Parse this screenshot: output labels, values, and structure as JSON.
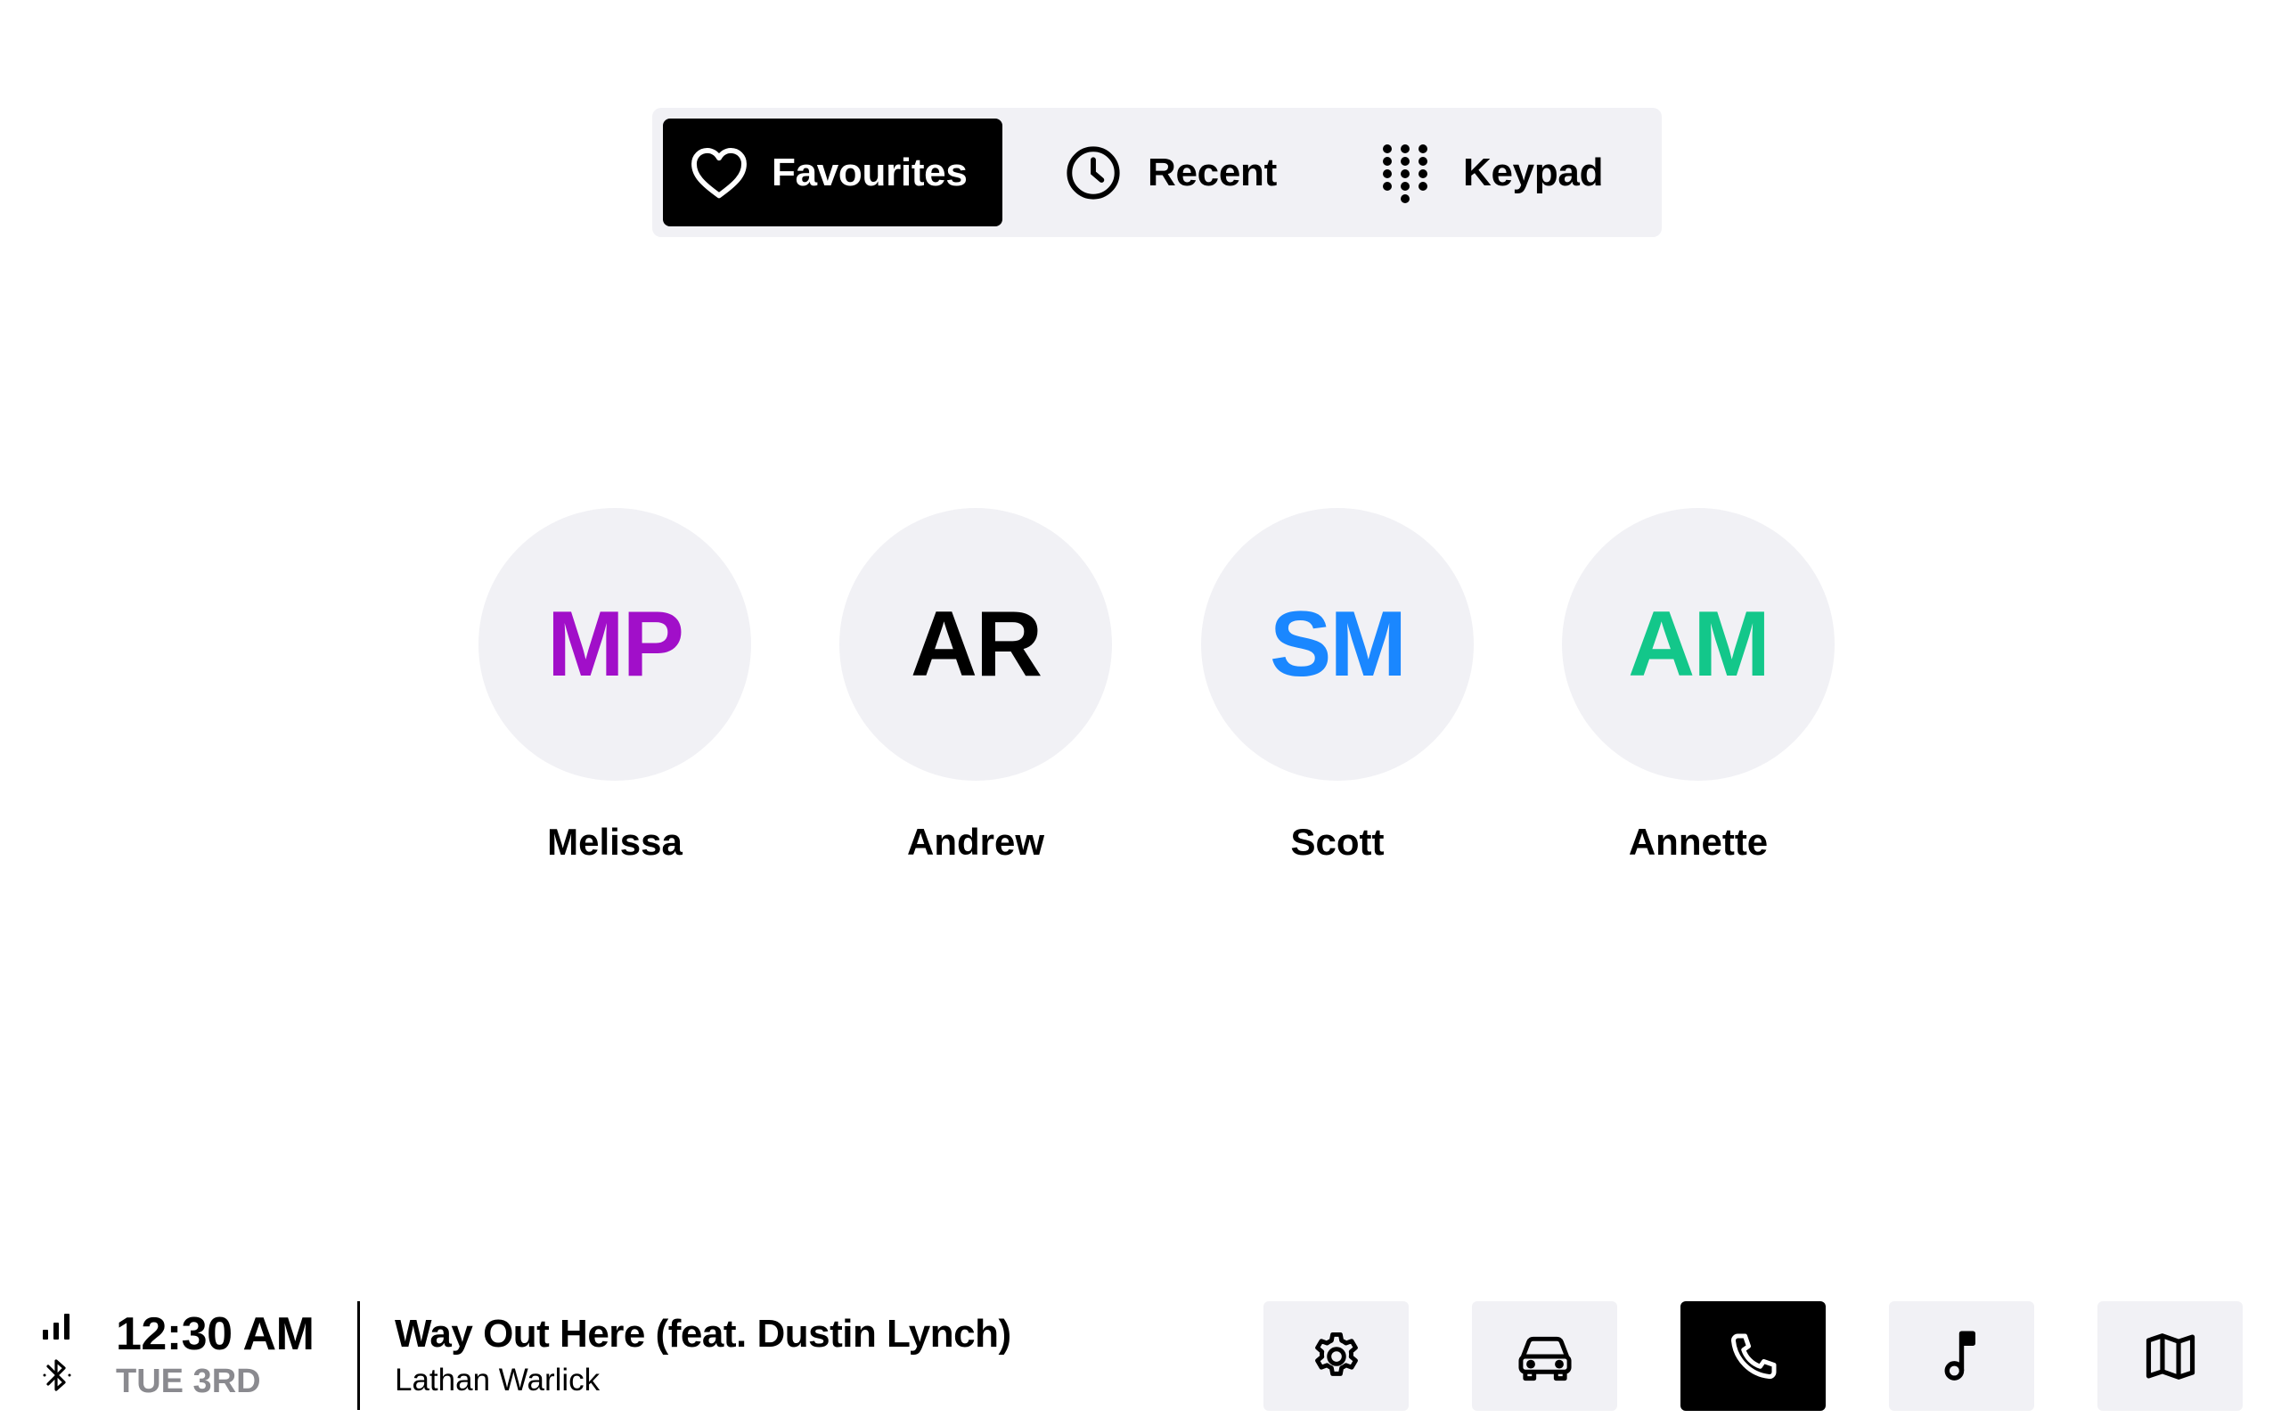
{
  "tabs": [
    {
      "label": "Favourites",
      "icon": "heart-icon",
      "active": true
    },
    {
      "label": "Recent",
      "icon": "clock-icon",
      "active": false
    },
    {
      "label": "Keypad",
      "icon": "keypad-icon",
      "active": false
    }
  ],
  "contacts": [
    {
      "initials": "MP",
      "name": "Melissa",
      "color": "#a10fc9"
    },
    {
      "initials": "AR",
      "name": "Andrew",
      "color": "#000000"
    },
    {
      "initials": "SM",
      "name": "Scott",
      "color": "#1a87ff"
    },
    {
      "initials": "AM",
      "name": "Annette",
      "color": "#13c78a"
    }
  ],
  "status": {
    "time": "12:30 AM",
    "date": "TUE 3RD",
    "icons": [
      "signal-icon",
      "bluetooth-icon"
    ]
  },
  "now_playing": {
    "title": "Way Out Here (feat. Dustin Lynch)",
    "artist": "Lathan Warlick"
  },
  "dock": [
    {
      "icon": "settings-icon",
      "active": false
    },
    {
      "icon": "car-icon",
      "active": false
    },
    {
      "icon": "phone-icon",
      "active": true
    },
    {
      "icon": "music-icon",
      "active": false
    },
    {
      "icon": "map-icon",
      "active": false
    }
  ],
  "colors": {
    "surface": "#f1f1f5",
    "active": "#000000",
    "muted_text": "#8a8a8f"
  }
}
